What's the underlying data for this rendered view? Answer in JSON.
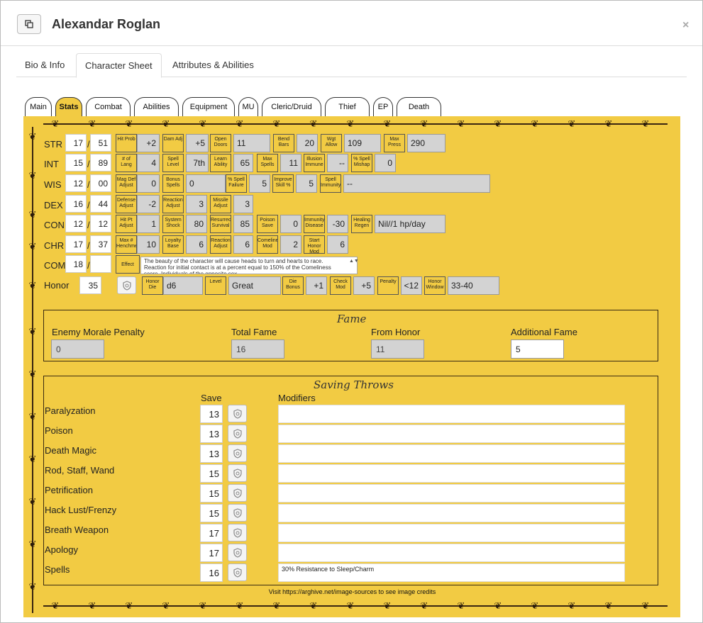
{
  "window": {
    "title": "Alexandar Roglan",
    "close": "×"
  },
  "tabs": [
    "Bio & Info",
    "Character Sheet",
    "Attributes & Abilities"
  ],
  "sheet_tabs": [
    "Main",
    "Stats",
    "Combat",
    "Abilities",
    "Equipment",
    "MU",
    "Cleric/Druid",
    "Thief",
    "EP",
    "Death"
  ],
  "stats": {
    "str": {
      "label": "STR",
      "score": "17",
      "sep": "/",
      "pct": "51",
      "fields": [
        [
          "Hit Prob",
          "+2"
        ],
        [
          "Dam Adj",
          "+5"
        ],
        [
          "Open Doors",
          "11"
        ],
        [
          "Bend Bars",
          "20"
        ],
        [
          "Wgt Allow",
          "109"
        ],
        [
          "Max Press",
          "290"
        ]
      ]
    },
    "int": {
      "label": "INT",
      "score": "15",
      "sep": "/",
      "pct": "89",
      "fields": [
        [
          "# of Lang",
          "4"
        ],
        [
          "Spell Level",
          "7th"
        ],
        [
          "Learn Ability",
          "65"
        ],
        [
          "Max Spells",
          "11"
        ],
        [
          "Illusion Immune",
          "--"
        ],
        [
          "% Spell Mishap",
          "0"
        ]
      ]
    },
    "wis": {
      "label": "WIS",
      "score": "12",
      "sep": "/",
      "pct": "00",
      "fields": [
        [
          "Mag Def Adjust",
          "0"
        ],
        [
          "Bonus Spells",
          "0"
        ],
        [
          "% Spell Failure",
          "5"
        ],
        [
          "Improve Skill %",
          "5"
        ],
        [
          "Spell Immunity",
          "--"
        ]
      ]
    },
    "dex": {
      "label": "DEX",
      "score": "16",
      "sep": "/",
      "pct": "44",
      "fields": [
        [
          "Defense Adjust",
          "-2"
        ],
        [
          "Reaction Adjust",
          "3"
        ],
        [
          "Missile Adjust",
          "3"
        ]
      ]
    },
    "con": {
      "label": "CON",
      "score": "12",
      "sep": "/",
      "pct": "12",
      "fields": [
        [
          "Hit Pt Adjust",
          "1"
        ],
        [
          "System Shock",
          "80"
        ],
        [
          "Resurrect Survival",
          "85"
        ],
        [
          "Poison Save",
          "0"
        ],
        [
          "Immunity Disease",
          "-30"
        ],
        [
          "Healing Regen",
          "Nil//1 hp/day"
        ]
      ]
    },
    "chr": {
      "label": "CHR",
      "score": "17",
      "sep": "/",
      "pct": "37",
      "fields": [
        [
          "Max # Henchmen",
          "10"
        ],
        [
          "Loyalty Base",
          "6"
        ],
        [
          "Reaction Adjust",
          "6"
        ],
        [
          "Comeliness Mod",
          "2"
        ],
        [
          "Start Honor Mod",
          "6"
        ]
      ]
    },
    "com": {
      "label": "COM",
      "score": "18",
      "sep": "/",
      "pct": "",
      "effect_label": "Effect",
      "effect_text": "The beauty of the character will cause heads to turn and hearts to race.  Reaction for initial contact is at a percent equal to 150% of the Comeliness score.  Individuals of the opposite sex"
    },
    "honor": {
      "label": "Honor",
      "value": "35",
      "fields": [
        [
          "Honor Die",
          "d6"
        ],
        [
          "Level",
          "Great"
        ],
        [
          "Die Bonus",
          "+1"
        ],
        [
          "Check Mod",
          "+5"
        ],
        [
          "Penalty",
          "<12"
        ],
        [
          "Honor Window",
          "33-40"
        ]
      ]
    }
  },
  "fame": {
    "title": "Fame",
    "items": [
      {
        "label": "Enemy Morale Penalty",
        "value": "0"
      },
      {
        "label": "Total Fame",
        "value": "16"
      },
      {
        "label": "From Honor",
        "value": "11"
      },
      {
        "label": "Additional Fame",
        "value": "5"
      }
    ]
  },
  "saves": {
    "title": "Saving Throws",
    "save_header": "Save",
    "mod_header": "Modifiers",
    "rows": [
      {
        "name": "Paralyzation",
        "save": "13",
        "mod": ""
      },
      {
        "name": "Poison",
        "save": "13",
        "mod": ""
      },
      {
        "name": "Death Magic",
        "save": "13",
        "mod": ""
      },
      {
        "name": "Rod, Staff, Wand",
        "save": "15",
        "mod": ""
      },
      {
        "name": "Petrification",
        "save": "15",
        "mod": ""
      },
      {
        "name": "Hack Lust/Frenzy",
        "save": "15",
        "mod": ""
      },
      {
        "name": "Breath Weapon",
        "save": "17",
        "mod": ""
      },
      {
        "name": "Apology",
        "save": "17",
        "mod": ""
      },
      {
        "name": "Spells",
        "save": "16",
        "mod": "30% Resistance to Sleep/Charm"
      }
    ]
  },
  "credit": "Visit https://arghive.net/image-sources to see image credits"
}
